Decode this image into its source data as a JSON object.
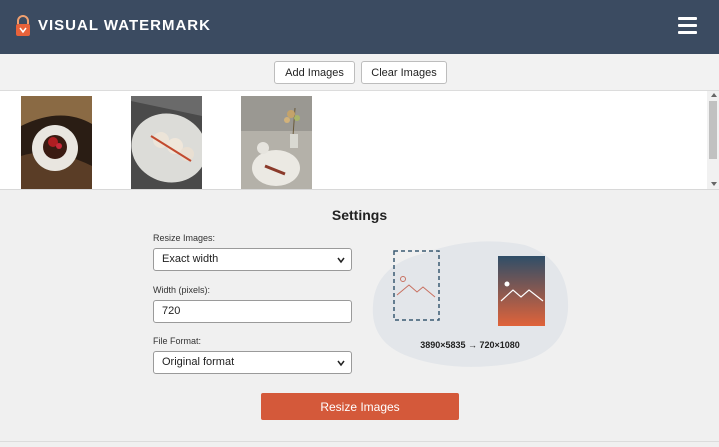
{
  "app": {
    "title": "VISUAL WATERMARK"
  },
  "toolbar": {
    "add_label": "Add Images",
    "clear_label": "Clear Images"
  },
  "gallery": {
    "items": [
      {
        "name": "chocolate-cake-photo"
      },
      {
        "name": "pastry-plate-photo"
      },
      {
        "name": "dessert-flowers-photo"
      }
    ]
  },
  "settings": {
    "title": "Settings",
    "resize_label": "Resize Images:",
    "resize_value": "Exact width",
    "width_label": "Width (pixels):",
    "width_value": "720",
    "format_label": "File Format:",
    "format_value": "Original format",
    "dimensions": "3890×5835 → 720×1080"
  },
  "action": {
    "label": "Resize Images"
  },
  "colors": {
    "header": "#3b4b61",
    "accent": "#d4593a"
  },
  "icons": {
    "logo": "lock-icon",
    "menu": "hamburger-menu-icon",
    "select": "chevron-down-icon"
  }
}
